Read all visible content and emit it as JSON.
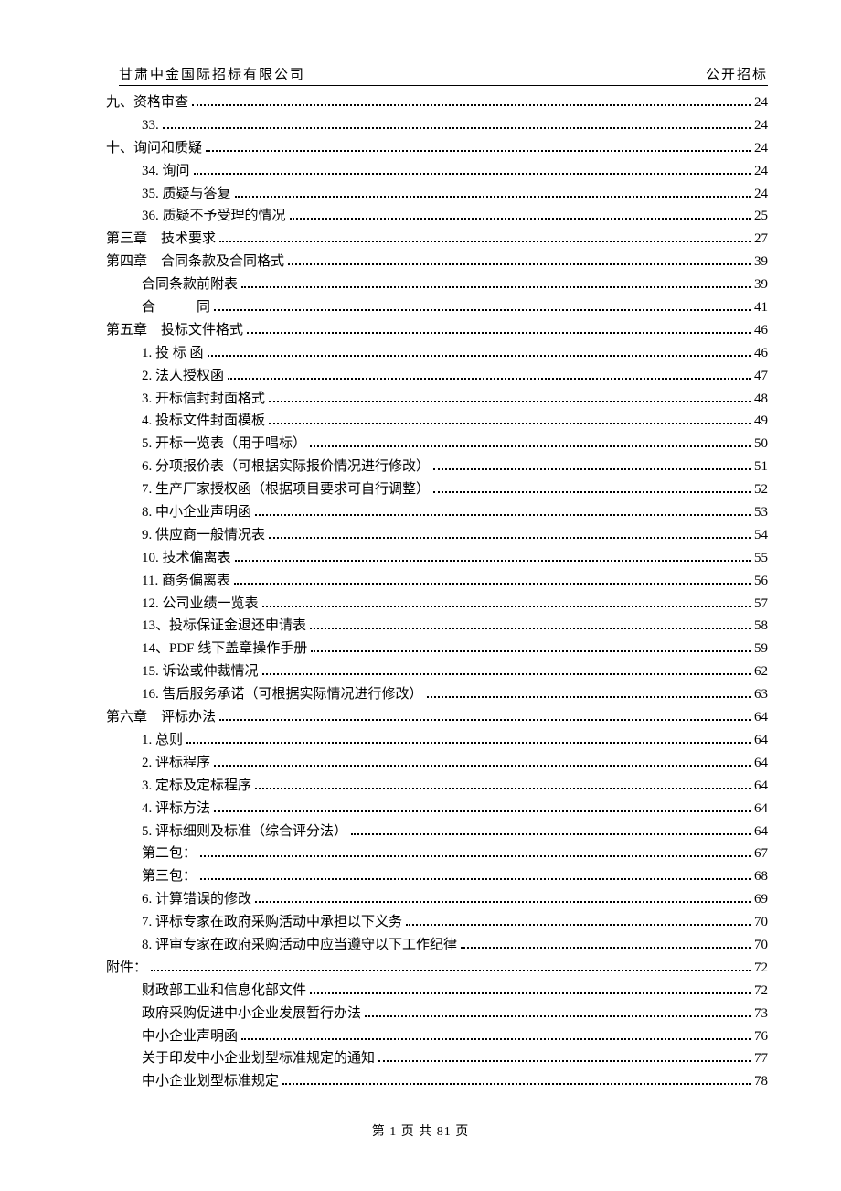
{
  "header": {
    "left": "甘肃中金国际招标有限公司",
    "right": "公开招标"
  },
  "toc": [
    {
      "level": 0,
      "label": "九、资格审查",
      "page": "24"
    },
    {
      "level": 1,
      "label": "33. ",
      "page": "24"
    },
    {
      "level": 0,
      "label": "十、询问和质疑",
      "page": "24"
    },
    {
      "level": 1,
      "label": "34. 询问",
      "page": "24"
    },
    {
      "level": 1,
      "label": "35. 质疑与答复",
      "page": "24"
    },
    {
      "level": 1,
      "label": "36. 质疑不予受理的情况",
      "page": "25"
    },
    {
      "level": 0,
      "label": "第三章　技术要求",
      "page": "27"
    },
    {
      "level": 0,
      "label": "第四章　合同条款及合同格式",
      "page": "39"
    },
    {
      "level": 1,
      "label": "合同条款前附表",
      "page": "39"
    },
    {
      "level": 1,
      "label": "合　　　同",
      "page": "41"
    },
    {
      "level": 0,
      "label": "第五章　投标文件格式",
      "page": "46"
    },
    {
      "level": 1,
      "label": "1. 投 标 函",
      "page": "46"
    },
    {
      "level": 1,
      "label": "2. 法人授权函",
      "page": "47"
    },
    {
      "level": 1,
      "label": "3. 开标信封封面格式 ",
      "page": "48"
    },
    {
      "level": 1,
      "label": "4. 投标文件封面模板 ",
      "page": "49"
    },
    {
      "level": 1,
      "label": "5. 开标一览表（用于唱标） ",
      "page": "50"
    },
    {
      "level": 1,
      "label": "6. 分项报价表（可根据实际报价情况进行修改） ",
      "page": "51"
    },
    {
      "level": 1,
      "label": "7. 生产厂家授权函（根据项目要求可自行调整） ",
      "page": "52"
    },
    {
      "level": 1,
      "label": "8. 中小企业声明函 ",
      "page": "53"
    },
    {
      "level": 1,
      "label": "9. 供应商一般情况表 ",
      "page": "54"
    },
    {
      "level": 1,
      "label": "10. 技术偏离表 ",
      "page": "55"
    },
    {
      "level": 1,
      "label": "11. 商务偏离表 ",
      "page": "56"
    },
    {
      "level": 1,
      "label": "12. 公司业绩一览表 ",
      "page": "57"
    },
    {
      "level": 1,
      "label": "13、投标保证金退还申请表 ",
      "page": "58"
    },
    {
      "level": 1,
      "label": "14、PDF 线下盖章操作手册 ",
      "page": "59"
    },
    {
      "level": 1,
      "label": "15. 诉讼或仲裁情况 ",
      "page": "62"
    },
    {
      "level": 1,
      "label": "16. 售后服务承诺（可根据实际情况进行修改） ",
      "page": "63"
    },
    {
      "level": 0,
      "label": "第六章　评标办法",
      "page": "64"
    },
    {
      "level": 1,
      "label": "1. 总则",
      "page": "64"
    },
    {
      "level": 1,
      "label": "2. 评标程序",
      "page": "64"
    },
    {
      "level": 1,
      "label": "3. 定标及定标程序",
      "page": "64"
    },
    {
      "level": 1,
      "label": "4. 评标方法",
      "page": "64"
    },
    {
      "level": 1,
      "label": "5. 评标细则及标准（综合评分法） ",
      "page": "64"
    },
    {
      "level": 1,
      "label": "第二包： ",
      "page": "67"
    },
    {
      "level": 1,
      "label": "第三包： ",
      "page": "68"
    },
    {
      "level": 1,
      "label": "6.  计算错误的修改",
      "page": "69"
    },
    {
      "level": 1,
      "label": "7. 评标专家在政府采购活动中承担以下义务",
      "page": "70"
    },
    {
      "level": 1,
      "label": "8. 评审专家在政府采购活动中应当遵守以下工作纪律",
      "page": "70"
    },
    {
      "level": 0,
      "label": "附件： ",
      "page": "72"
    },
    {
      "level": 1,
      "label": "财政部工业和信息化部文件",
      "page": "72"
    },
    {
      "level": 1,
      "label": "政府采购促进中小企业发展暂行办法",
      "page": "73"
    },
    {
      "level": 1,
      "label": "中小企业声明函",
      "page": "76"
    },
    {
      "level": 1,
      "label": "关于印发中小企业划型标准规定的通知 ",
      "page": "77"
    },
    {
      "level": 1,
      "label": "中小企业划型标准规定",
      "page": "78"
    }
  ],
  "footer": {
    "text": "第 1 页 共 81 页"
  }
}
